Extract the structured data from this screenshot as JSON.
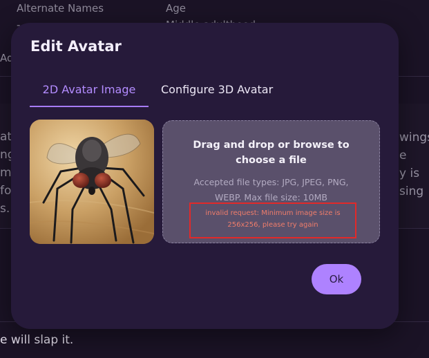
{
  "background": {
    "alt_names_label": "Alternate Names",
    "alt_names_value": "-",
    "age_label": "Age",
    "age_value": "Middle adulthood",
    "side_left_fragment": "Ad",
    "left_lines": [
      "at",
      "ng",
      "mp",
      "fo",
      "s."
    ],
    "right_lines": [
      "wings",
      "e",
      "y is",
      "sing"
    ],
    "bottom_text": "e will slap it."
  },
  "modal": {
    "title": "Edit Avatar",
    "tabs": [
      {
        "label": "2D Avatar Image",
        "active": true
      },
      {
        "label": "Configure 3D Avatar",
        "active": false
      }
    ],
    "avatar_image": "housefly-photo",
    "dropzone": {
      "title_line1": "Drag and drop or browse to",
      "title_line2": "choose a file",
      "types_line1": "Accepted file types: JPG, JPEG, PNG,",
      "types_line2": "WEBP. Max file size: 10MB",
      "error_line1": "invalid request: Minimum image size is",
      "error_line2": "256x256, please try again"
    },
    "ok_label": "Ok"
  },
  "colors": {
    "accent": "#ae82ff",
    "modal_bg": "#261a3a",
    "error": "#e32929"
  }
}
